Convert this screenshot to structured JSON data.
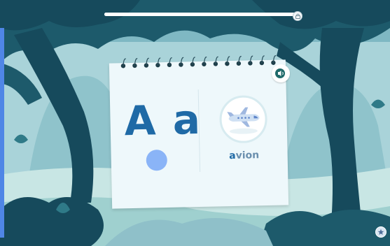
{
  "progress": {
    "value": 0.98,
    "lock_icon": "lock-icon"
  },
  "card": {
    "letter_upper": "A",
    "letter_lower": "a",
    "word_first_letter": "a",
    "word_rest": "vion",
    "picture": "airplane-icon"
  },
  "controls": {
    "sound_icon": "speaker-icon",
    "star_icon": "star-icon"
  },
  "colors": {
    "letter": "#1f6aa6",
    "dot": "#8ab4f7",
    "forest_dark": "#164a5c",
    "forest_light": "#b7dbe0",
    "card": "#eef8fb"
  }
}
